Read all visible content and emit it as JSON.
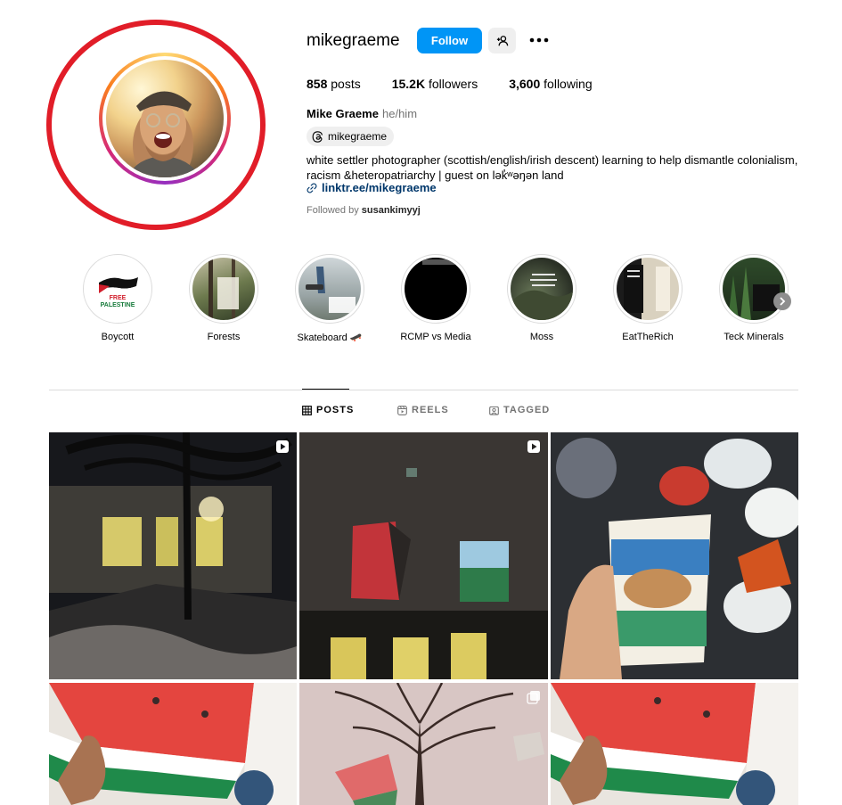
{
  "profile": {
    "username": "mikegraeme",
    "follow_label": "Follow",
    "posts_count": "858",
    "posts_label": "posts",
    "followers_count": "15.2K",
    "followers_label": "followers",
    "following_count": "3,600",
    "following_label": "following",
    "full_name": "Mike Graeme",
    "pronouns": "he/him",
    "threads_handle": "mikegraeme",
    "bio": "white settler photographer (scottish/english/irish descent) learning to help dismantle colonialism, racism &heteropatriarchy | guest on lək̓ʷəŋən land",
    "link": "linktr.ee/mikegraeme",
    "followed_by_prefix": "Followed by",
    "followed_by_user": "susankimyyj"
  },
  "highlights": [
    {
      "label": "Boycott"
    },
    {
      "label": "Forests"
    },
    {
      "label": "Skateboard 🛹"
    },
    {
      "label": "RCMP vs Media"
    },
    {
      "label": "Moss"
    },
    {
      "label": "EatTheRich"
    },
    {
      "label": "Teck Minerals"
    }
  ],
  "boycott_badge": {
    "line1": "FREE",
    "line2": "PALESTINE"
  },
  "tabs": [
    {
      "label": "POSTS",
      "icon": "grid-icon"
    },
    {
      "label": "REELS",
      "icon": "reels-icon"
    },
    {
      "label": "TAGGED",
      "icon": "tagged-icon"
    }
  ],
  "colors": {
    "follow_blue": "#0095f6",
    "link_navy": "#00376b",
    "annotation_red": "#e11d28",
    "muted_gray": "#737373"
  }
}
